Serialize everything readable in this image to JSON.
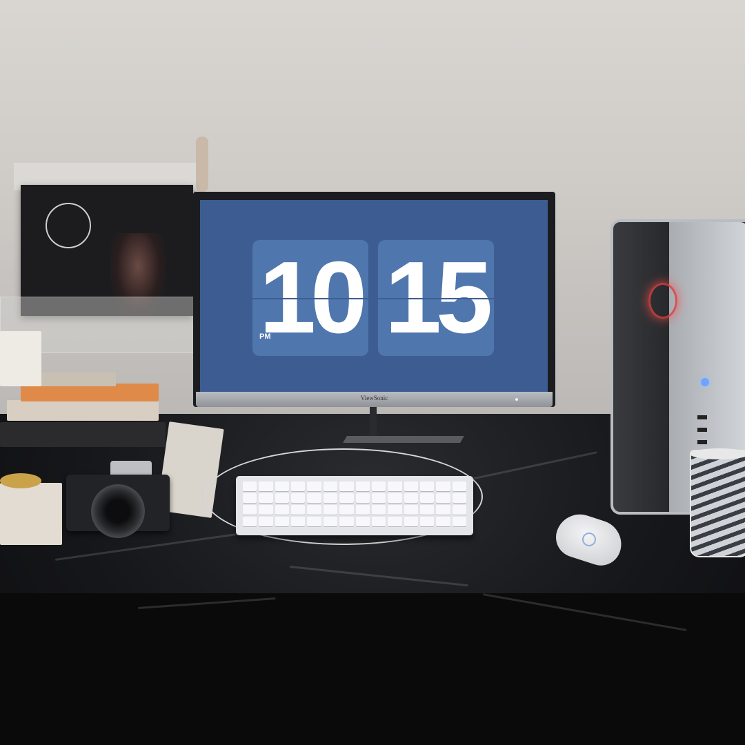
{
  "screen_clock": {
    "hours": "10",
    "minutes": "15",
    "period": "PM"
  },
  "monitor": {
    "brand": "ViewSonic"
  },
  "colors": {
    "screen_background": "#3d5d92",
    "flip_card": "#5076ae",
    "pc_led": "#d94040",
    "power_button": "#6fa3ff"
  }
}
